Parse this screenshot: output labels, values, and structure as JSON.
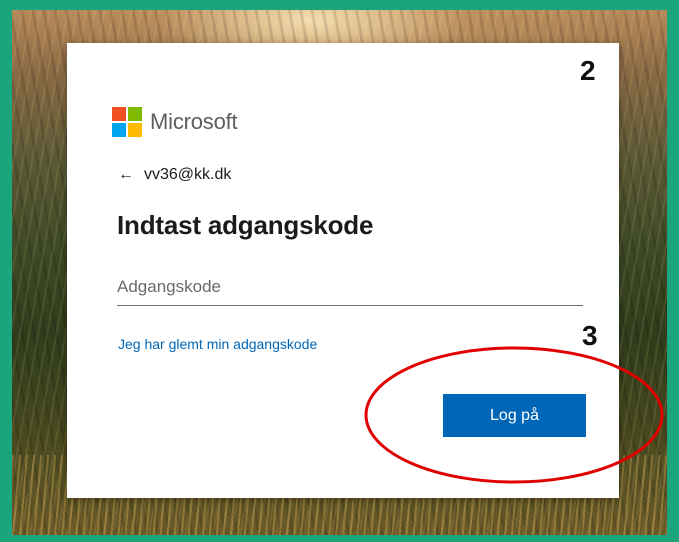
{
  "annotations": {
    "step_top": "2",
    "step_bottom": "3"
  },
  "brand": {
    "name": "Microsoft",
    "logo_colors": [
      "#f25022",
      "#7fba00",
      "#00a4ef",
      "#ffb900"
    ]
  },
  "identity": {
    "back_icon": "←",
    "email": "vv36@kk.dk"
  },
  "form": {
    "title": "Indtast adgangskode",
    "password_placeholder": "Adgangskode",
    "password_value": "",
    "forgot_link": "Jeg har glemt min adgangskode",
    "submit_label": "Log på"
  },
  "colors": {
    "frame": "#1aa57c",
    "accent": "#0067b8",
    "highlight": "#e00000"
  }
}
